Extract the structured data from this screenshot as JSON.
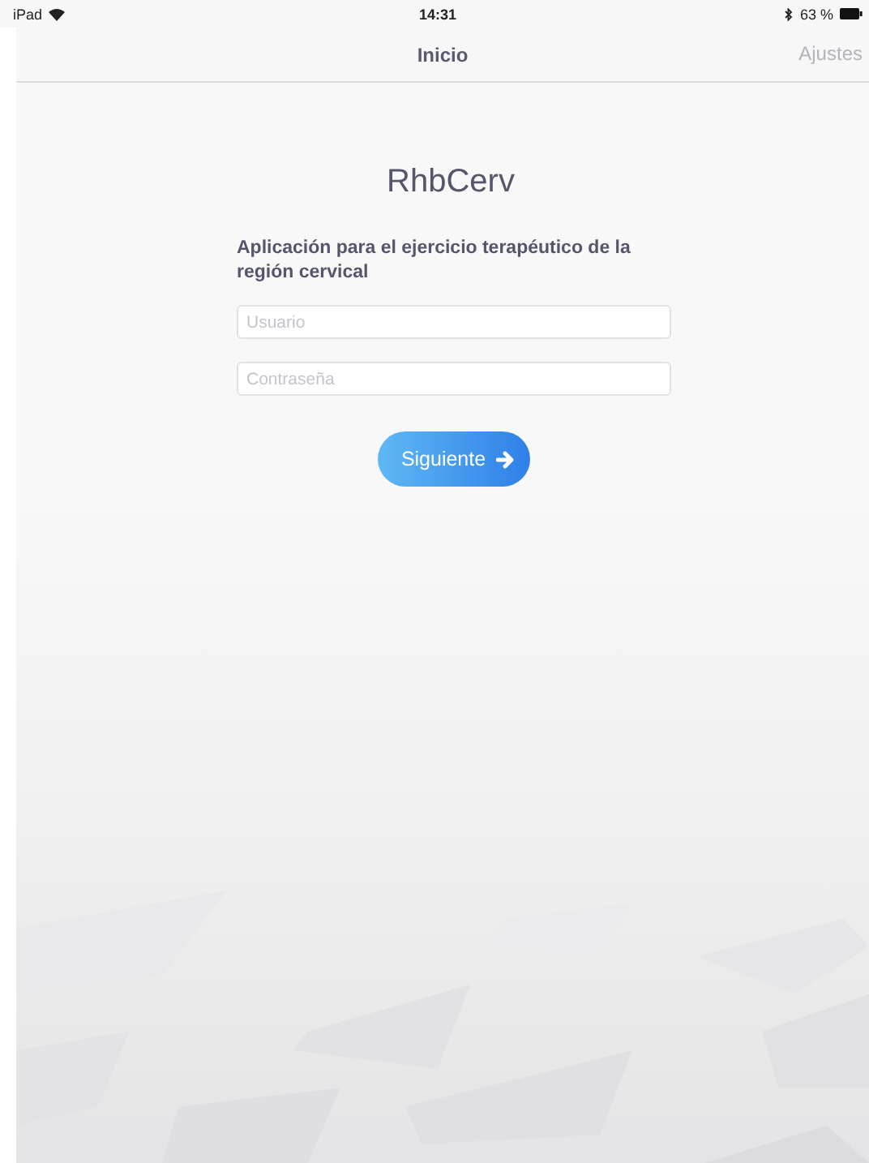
{
  "status_bar": {
    "device": "iPad",
    "time": "14:31",
    "battery": "63 %"
  },
  "nav_bar": {
    "title": "Inicio",
    "right_button": "Ajustes"
  },
  "app": {
    "title": "RhbCerv",
    "description": "Aplicación para el ejercicio terapéutico de la región cervical"
  },
  "fields": [
    {
      "placeholder": "Usuario"
    },
    {
      "placeholder": "Contraseña"
    }
  ],
  "button": {
    "label": "Siguiente"
  }
}
